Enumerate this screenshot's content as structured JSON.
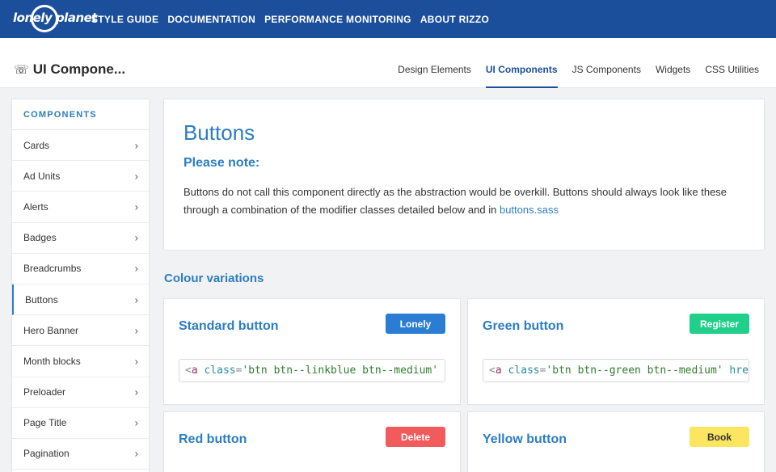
{
  "brand": {
    "logo_text": "lonely planet"
  },
  "topnav": [
    {
      "label": "STYLE GUIDE"
    },
    {
      "label": "DOCUMENTATION"
    },
    {
      "label": "PERFORMANCE MONITORING"
    },
    {
      "label": "ABOUT RIZZO"
    }
  ],
  "subheader": {
    "title": "UI Compone...",
    "icon": "components-icon",
    "tabs": [
      {
        "label": "Design Elements"
      },
      {
        "label": "UI Components"
      },
      {
        "label": "JS Components"
      },
      {
        "label": "Widgets"
      },
      {
        "label": "CSS Utilities"
      }
    ],
    "active_tab": "UI Components"
  },
  "sidebar": {
    "heading": "COMPONENTS",
    "items": [
      {
        "label": "Cards"
      },
      {
        "label": "Ad Units"
      },
      {
        "label": "Alerts"
      },
      {
        "label": "Badges"
      },
      {
        "label": "Breadcrumbs"
      },
      {
        "label": "Buttons"
      },
      {
        "label": "Hero Banner"
      },
      {
        "label": "Month blocks"
      },
      {
        "label": "Preloader"
      },
      {
        "label": "Page Title"
      },
      {
        "label": "Pagination"
      }
    ],
    "active_item": "Buttons",
    "chevron": "›"
  },
  "intro": {
    "title": "Buttons",
    "subtitle": "Please note:",
    "body": "Buttons do not call this component directly as the abstraction would be overkill. Buttons should always look like these through a combination of the modifier classes detailed below and in",
    "link": "buttons.sass"
  },
  "section_title": "Colour variations",
  "cards": [
    {
      "title": "Standard button",
      "button": "Lonely",
      "button_color": "#2b7dd4",
      "button_text_color": "#ffffff",
      "code": {
        "tag": "a",
        "attr": "class",
        "value": "'btn btn--linkblue btn--medium'",
        "rest": ""
      }
    },
    {
      "title": "Green button",
      "button": "Register",
      "button_color": "#1fcf8a",
      "button_text_color": "#ffffff",
      "code": {
        "tag": "a",
        "attr": "class",
        "value": "'btn btn--green btn--medium'",
        "rest": " hre"
      }
    },
    {
      "title": "Red button",
      "button": "Delete",
      "button_color": "#f25b5b",
      "button_text_color": "#ffffff"
    },
    {
      "title": "Yellow button",
      "button": "Book",
      "button_color": "#fbe561",
      "button_text_color": "#333333"
    }
  ],
  "colors": {
    "brand_blue": "#1c4f9b",
    "link_blue": "#2b7dc4"
  }
}
